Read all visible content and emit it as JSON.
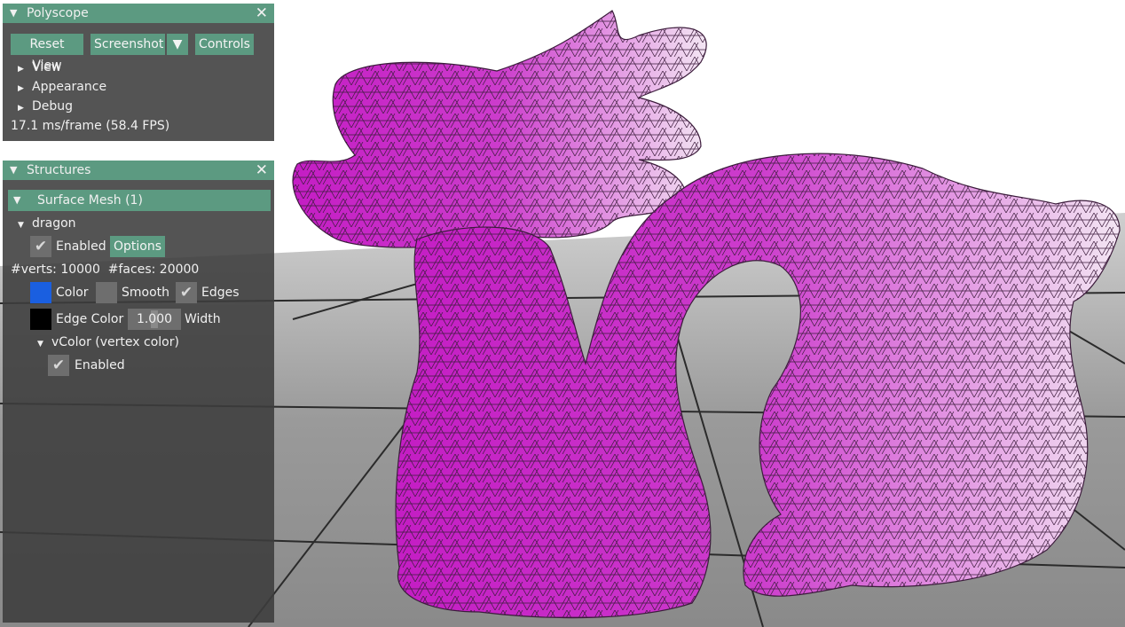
{
  "polyscope": {
    "title": "Polyscope",
    "close": "✕",
    "buttons": {
      "reset_view": "Reset View",
      "screenshot": "Screenshot",
      "screenshot_arrow": "▼",
      "controls": "Controls"
    },
    "tree": [
      "View",
      "Appearance",
      "Debug"
    ],
    "fps": "17.1 ms/frame (58.4 FPS)"
  },
  "structures": {
    "title": "Structures",
    "close": "✕",
    "header": "Surface Mesh (1)",
    "mesh": {
      "name": "dragon",
      "enabled_label": "Enabled",
      "options_label": "Options",
      "stats": "#verts: 10000  #faces: 20000",
      "color_label": "Color",
      "color_value": "#1a5fe0",
      "smooth_label": "Smooth",
      "edges_label": "Edges",
      "edge_color_label": "Edge Color",
      "edge_color_value": "#000000",
      "width_value": "1.000",
      "width_label": "Width",
      "quantity": {
        "name": "vColor (vertex color)",
        "enabled_label": "Enabled"
      }
    }
  },
  "colors": {
    "accent": "#5c9a81",
    "mesh": "#d22fd2",
    "ground": "#7a7a7a"
  }
}
